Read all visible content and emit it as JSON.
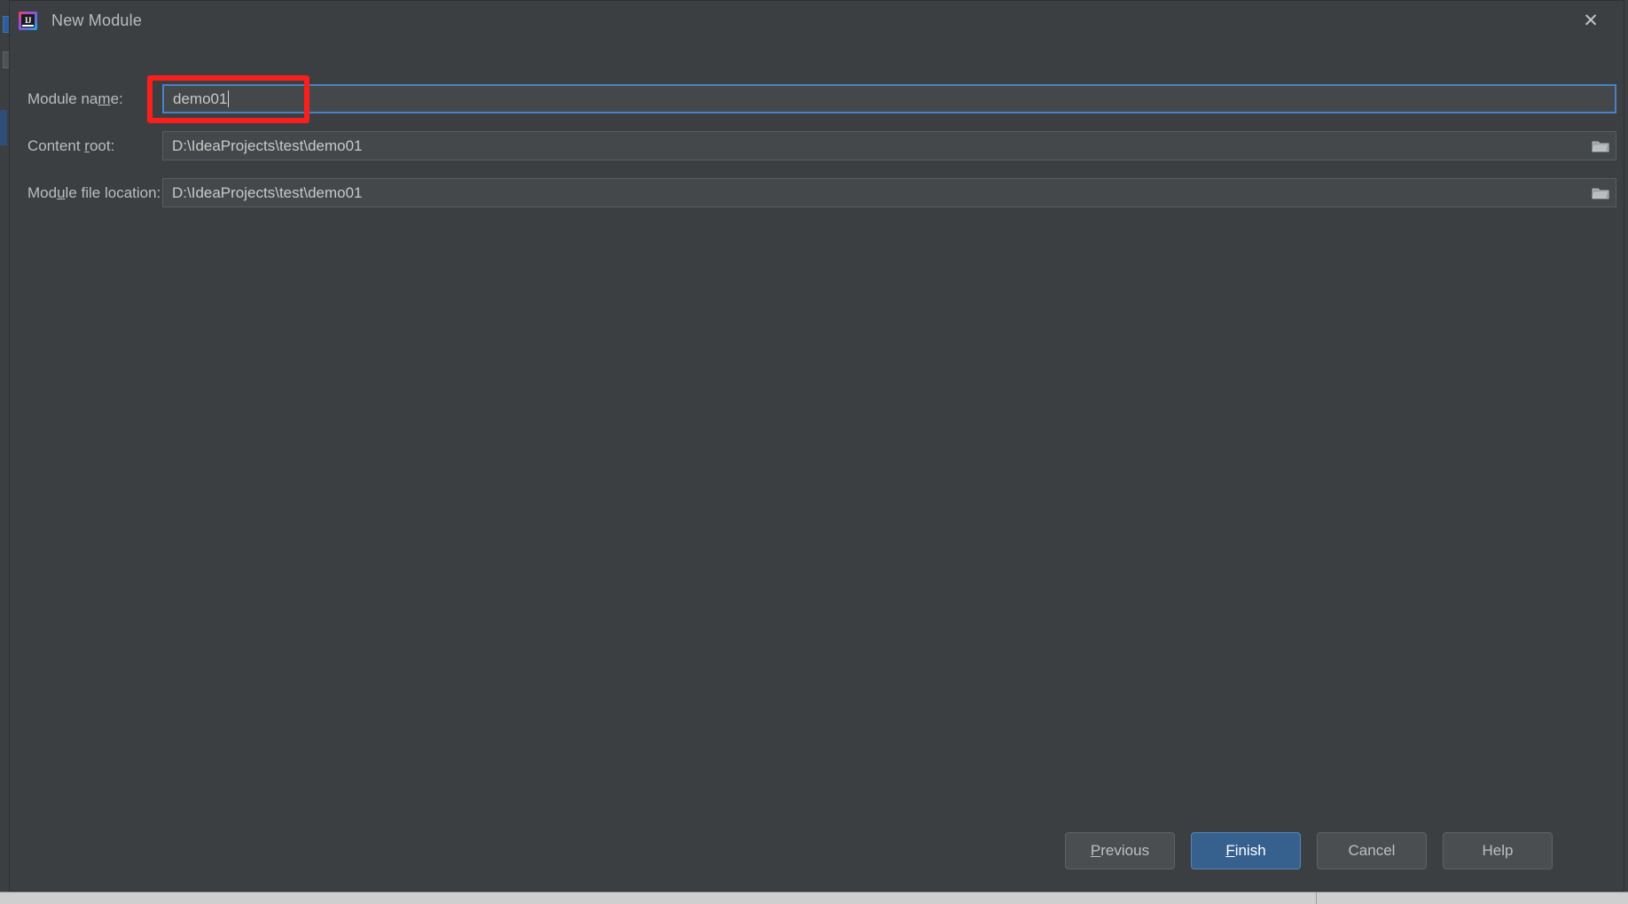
{
  "window": {
    "title": "New Module",
    "app_icon": "intellij-idea-icon",
    "close_icon": "✕"
  },
  "background": {
    "right_close_icon": "✕"
  },
  "form": {
    "rows": [
      {
        "label_pre": "Module na",
        "label_mnemonic": "m",
        "label_post": "e:",
        "value": "demo01",
        "focused": true,
        "has_browse": false
      },
      {
        "label_pre": "Content ",
        "label_mnemonic": "r",
        "label_post": "oot:",
        "value": "D:\\IdeaProjects\\test\\demo01",
        "focused": false,
        "has_browse": true
      },
      {
        "label_pre": "Mod",
        "label_mnemonic": "u",
        "label_post": "le file location:",
        "value": "D:\\IdeaProjects\\test\\demo01",
        "focused": false,
        "has_browse": true
      }
    ]
  },
  "annotation": {
    "color": "#fc1d1d",
    "target": "module-name-field"
  },
  "footer": {
    "buttons": [
      {
        "pre": "",
        "mnemonic": "P",
        "post": "revious",
        "primary": false,
        "name": "previous-button"
      },
      {
        "pre": "",
        "mnemonic": "F",
        "post": "inish",
        "primary": true,
        "name": "finish-button"
      },
      {
        "pre": "Cancel",
        "mnemonic": "",
        "post": "",
        "primary": false,
        "name": "cancel-button"
      },
      {
        "pre": "Help",
        "mnemonic": "",
        "post": "",
        "primary": false,
        "name": "help-button"
      }
    ]
  },
  "colors": {
    "dialog_bg": "#3c3f41",
    "field_bg": "#45484a",
    "focus_border": "#4b81c4",
    "primary_button": "#36618f",
    "annotation_red": "#fc1d1d",
    "text": "#bcbcbc"
  }
}
